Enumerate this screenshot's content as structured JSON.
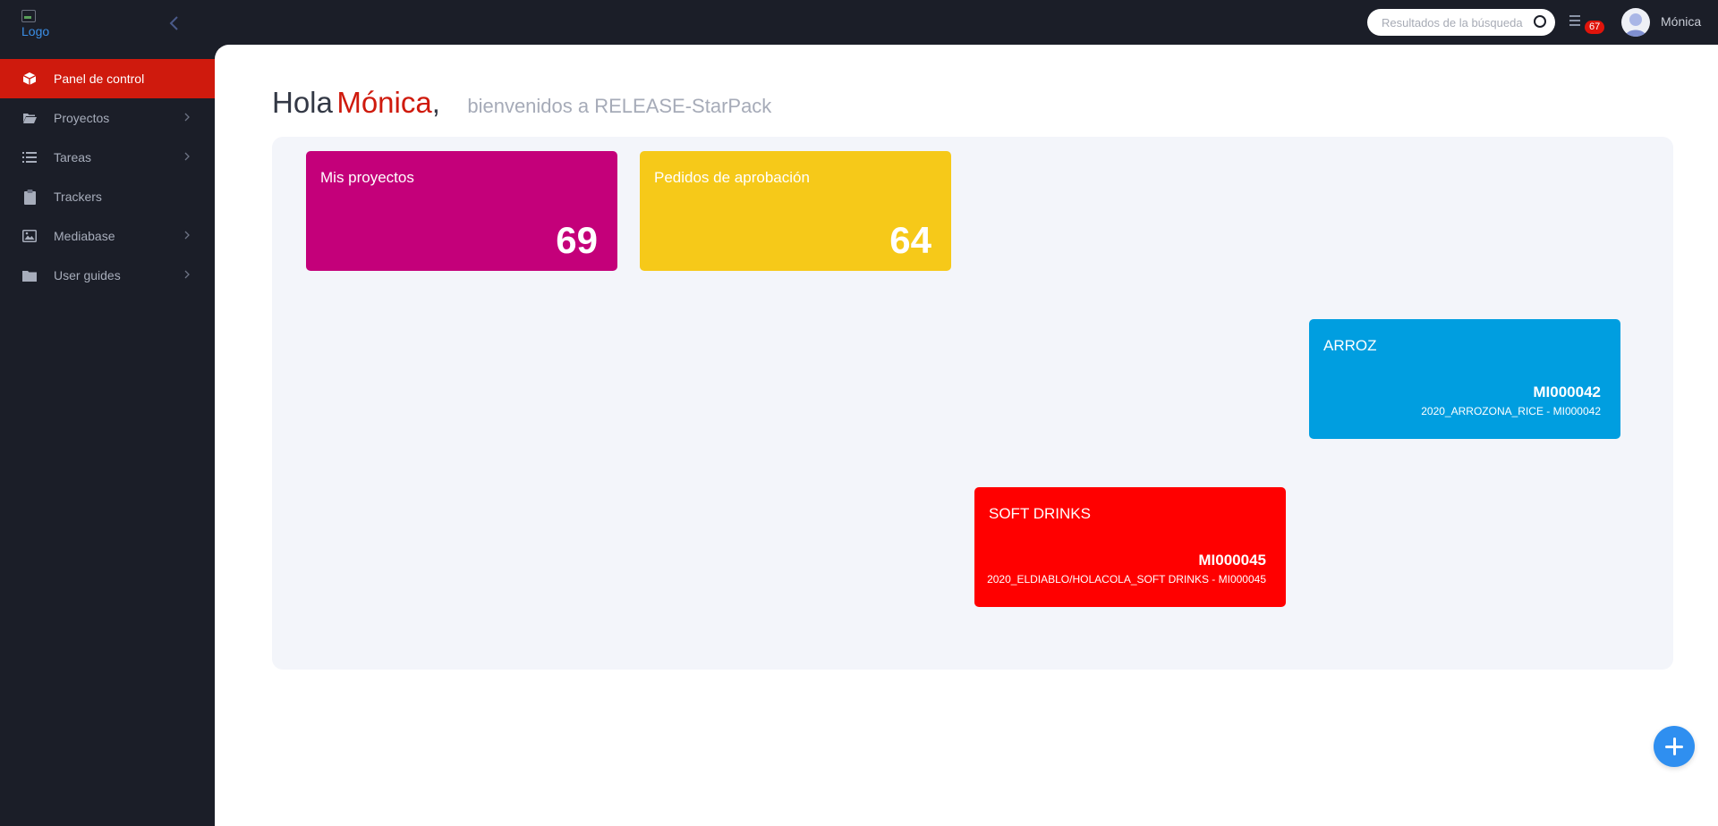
{
  "header": {
    "logo_alt": "Logo",
    "search_placeholder": "Resultados de la búsqueda",
    "notification_count": "67",
    "user_name": "Mónica"
  },
  "sidebar": {
    "items": [
      {
        "label": "Panel de control",
        "icon": "box-icon",
        "active": true
      },
      {
        "label": "Proyectos",
        "icon": "folder-open-icon"
      },
      {
        "label": "Tareas",
        "icon": "list-icon"
      },
      {
        "label": "Trackers",
        "icon": "clipboard-icon"
      },
      {
        "label": "Mediabase",
        "icon": "image-icon"
      },
      {
        "label": "User guides",
        "icon": "folder-icon"
      }
    ]
  },
  "main": {
    "greeting_hola": "Hola",
    "greeting_name": "Mónica",
    "greeting_comma": ",",
    "greeting_sub": "bienvenidos a RELEASE-StarPack",
    "cards": [
      {
        "title": "Mis proyectos",
        "value": "69",
        "color": "#c4007a"
      },
      {
        "title": "Pedidos de aprobación",
        "value": "64",
        "color": "#f6c919"
      }
    ],
    "project_cards": [
      {
        "title": "ARROZ",
        "code": "MI000042",
        "subtitle": "2020_ARROZONA_RICE - MI000042",
        "color": "#009ee0"
      },
      {
        "title": "SOFT DRINKS",
        "code": "MI000045",
        "subtitle": "2020_ELDIABLO/HOLACOLA_SOFT DRINKS - MI000045",
        "color": "#ff0000"
      }
    ]
  },
  "colors": {
    "dark_bg": "#1b1e28",
    "accent_red": "#cf1a0d",
    "fab_blue": "#2f8ff0"
  }
}
